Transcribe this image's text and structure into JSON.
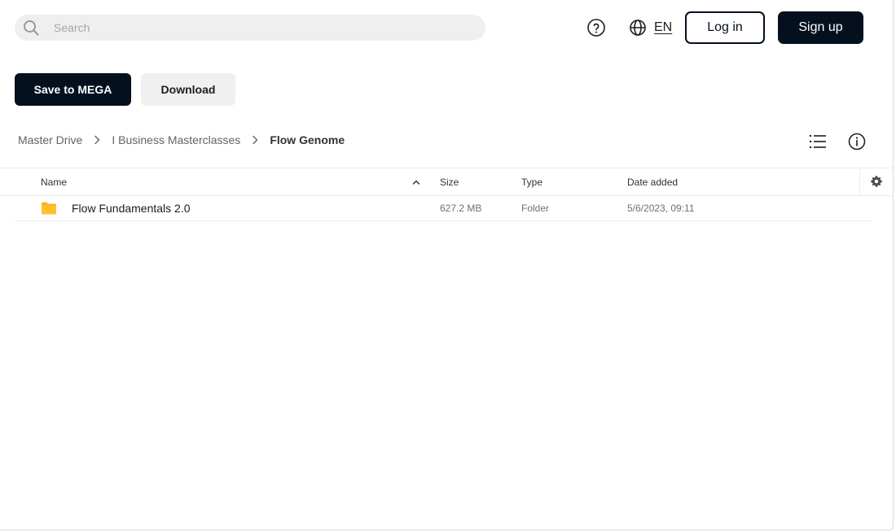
{
  "header": {
    "search_placeholder": "Search",
    "language": "EN",
    "login_label": "Log in",
    "signup_label": "Sign up"
  },
  "actions": {
    "save_label": "Save to MEGA",
    "download_label": "Download"
  },
  "breadcrumb": [
    {
      "label": "Master Drive"
    },
    {
      "label": "I Business Masterclasses"
    },
    {
      "label": "Flow Genome"
    }
  ],
  "table": {
    "columns": [
      "Name",
      "Size",
      "Type",
      "Date added"
    ],
    "rows": [
      {
        "name": "Flow Fundamentals 2.0",
        "size": "627.2 MB",
        "type": "Folder",
        "date": "5/6/2023, 09:11"
      }
    ]
  },
  "colors": {
    "primary": "#04101e",
    "secondary_bg": "#f0f0f0",
    "folder": "#fbb117"
  },
  "icons": {
    "search": "search-icon",
    "help": "help-circle-icon",
    "language": "globe-icon",
    "view": "list-view-icon",
    "info": "info-icon",
    "sort": "chevron-up-icon",
    "settings": "gear-icon",
    "folder": "folder-icon"
  }
}
